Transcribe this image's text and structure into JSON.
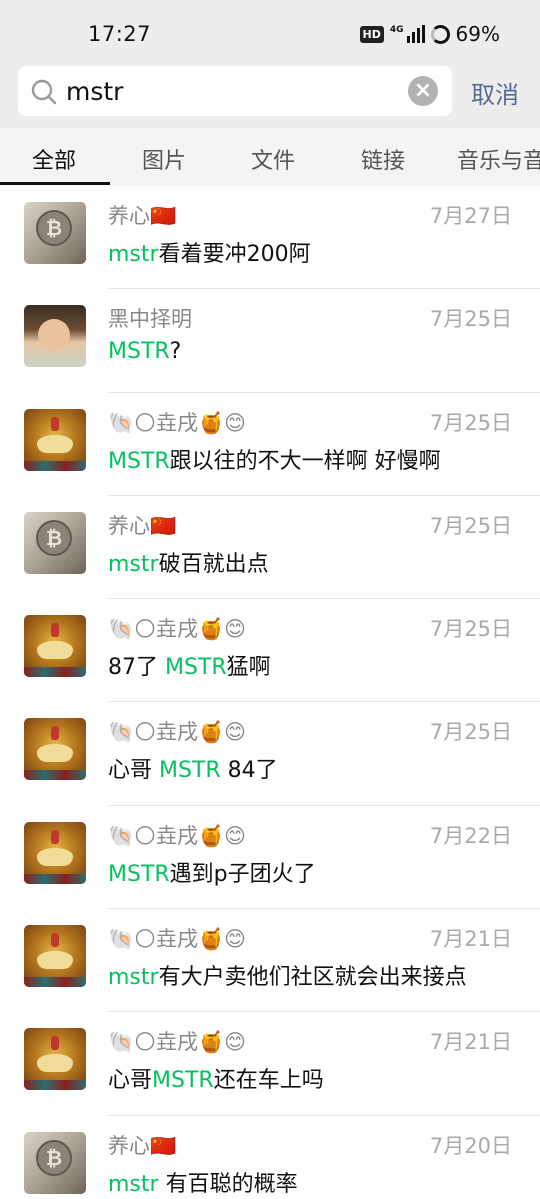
{
  "status_bar": {
    "time": "17:27",
    "hd": "HD",
    "network": "4G",
    "battery": "69%"
  },
  "search": {
    "query": "mstr",
    "cancel_label": "取消"
  },
  "tabs": [
    "全部",
    "图片",
    "文件",
    "链接",
    "音乐与音"
  ],
  "results": [
    {
      "name": "养心🇨🇳",
      "date": "7月27日",
      "pre": "",
      "kw": "mstr",
      "post": "看着要冲200阿",
      "avatar": "coin"
    },
    {
      "name": "黑中择明",
      "date": "7月25日",
      "pre": "",
      "kw": "MSTR",
      "post": "?",
      "avatar": "baby"
    },
    {
      "name": "🐚🌕垚戌🍯😊",
      "date": "7月25日",
      "pre": "",
      "kw": "MSTR",
      "post": "跟以往的不大一样啊 好慢啊",
      "avatar": "lotus"
    },
    {
      "name": "养心🇨🇳",
      "date": "7月25日",
      "pre": "",
      "kw": "mstr",
      "post": "破百就出点",
      "avatar": "coin"
    },
    {
      "name": "🐚🌕垚戌🍯😊",
      "date": "7月25日",
      "pre": "87了 ",
      "kw": "MSTR",
      "post": "猛啊",
      "avatar": "lotus"
    },
    {
      "name": "🐚🌕垚戌🍯😊",
      "date": "7月25日",
      "pre": "心哥 ",
      "kw": "MSTR",
      "post": " 84了",
      "avatar": "lotus"
    },
    {
      "name": "🐚🌕垚戌🍯😊",
      "date": "7月22日",
      "pre": "",
      "kw": "MSTR",
      "post": "遇到p子团火了",
      "avatar": "lotus"
    },
    {
      "name": "🐚🌕垚戌🍯😊",
      "date": "7月21日",
      "pre": "",
      "kw": "mstr",
      "post": "有大户卖他们社区就会出来接点",
      "avatar": "lotus"
    },
    {
      "name": "🐚🌕垚戌🍯😊",
      "date": "7月21日",
      "pre": "心哥",
      "kw": "MSTR",
      "post": "还在车上吗",
      "avatar": "lotus"
    },
    {
      "name": "养心🇨🇳",
      "date": "7月20日",
      "pre": "",
      "kw": "mstr",
      "post": " 有百聪的概率",
      "avatar": "coin"
    }
  ]
}
